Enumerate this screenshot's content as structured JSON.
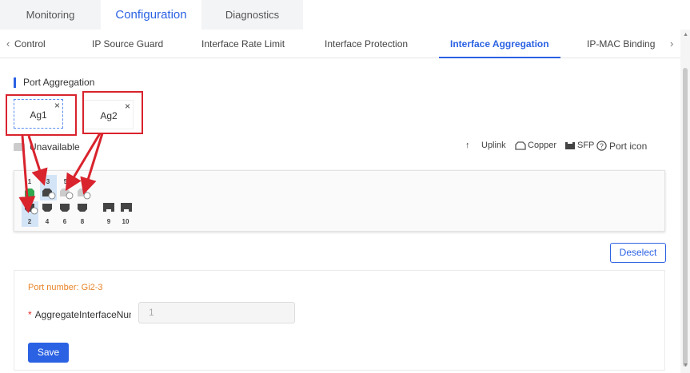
{
  "top_tabs": [
    {
      "label": "Monitoring"
    },
    {
      "label": "Configuration"
    },
    {
      "label": "Diagnostics"
    }
  ],
  "sub_tabs": [
    {
      "label": "Control"
    },
    {
      "label": "IP Source Guard"
    },
    {
      "label": "Interface Rate Limit"
    },
    {
      "label": "Interface Protection"
    },
    {
      "label": "Interface Aggregation"
    },
    {
      "label": "IP-MAC Binding"
    }
  ],
  "section": {
    "title": "Port Aggregation"
  },
  "aggregates": [
    {
      "label": "Ag1",
      "close": "×"
    },
    {
      "label": "Ag2",
      "close": "×"
    }
  ],
  "legend": {
    "unavailable": "Unavailable",
    "uplink_icon": "↑",
    "uplink": "Uplink",
    "copper": "Copper",
    "sfp": "SFP",
    "port_icon": "Port icon"
  },
  "ports": {
    "top": [
      "1",
      "3",
      "5",
      "7"
    ],
    "bottom": [
      "2",
      "4",
      "6",
      "8",
      "9",
      "10"
    ]
  },
  "deselect_label": "Deselect",
  "form": {
    "port_number": "Port number: Gi2-3",
    "required_mark": "*",
    "aggregate_label": "AggregateInterfaceNum",
    "aggregate_value": "1",
    "save_label": "Save"
  },
  "icons": {
    "left_chevron": "chevron-left-icon",
    "right_chevron": "chevron-right-icon",
    "help": "question-circle-icon"
  },
  "colors": {
    "accent": "#2b62e3",
    "annotation_red": "#d9232d",
    "port_number_orange": "#e8852a",
    "port_uplink_green": "#2fa84f"
  }
}
